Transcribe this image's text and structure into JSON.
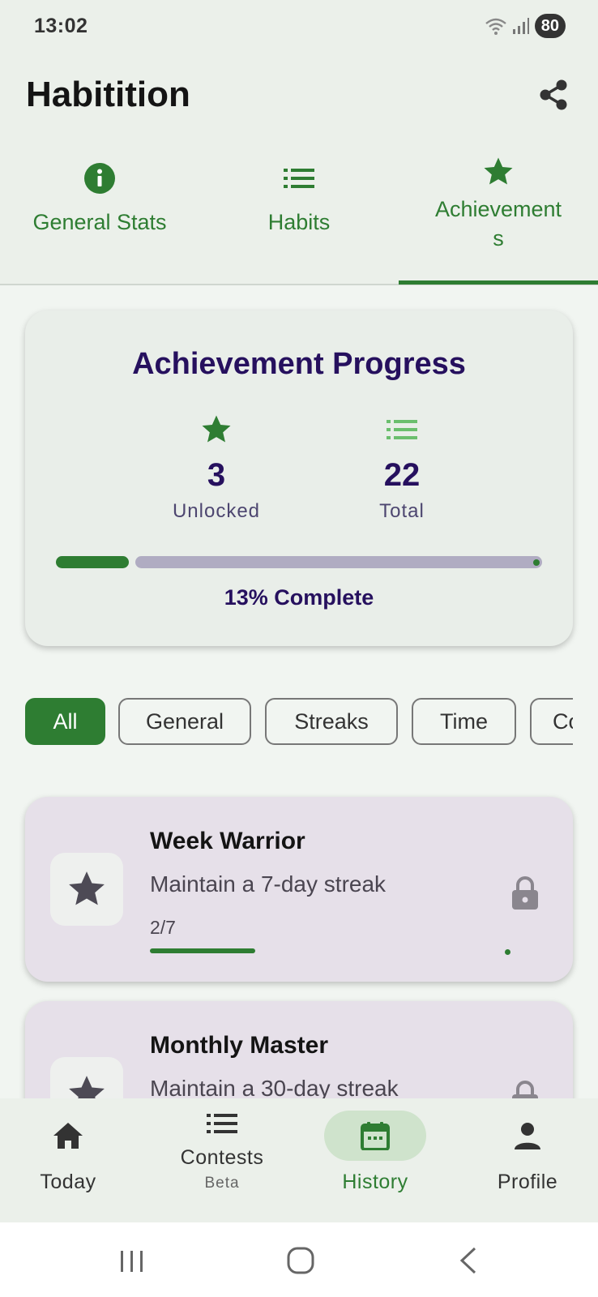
{
  "status_bar": {
    "time": "13:02",
    "battery": "80"
  },
  "app": {
    "title": "Habitition",
    "share_icon": "share-icon"
  },
  "tabs": [
    {
      "label": "General Stats",
      "icon": "info-icon"
    },
    {
      "label": "Habits",
      "icon": "list-icon"
    },
    {
      "label_line1": "Achievement",
      "label_line2": "s",
      "icon": "star-icon",
      "selected": true
    }
  ],
  "progress": {
    "title": "Achievement Progress",
    "unlocked_value": "3",
    "unlocked_label": "Unlocked",
    "total_value": "22",
    "total_label": "Total",
    "percent": 0.13,
    "complete_text": "13% Complete"
  },
  "filters": [
    {
      "label": "All",
      "selected": true
    },
    {
      "label": "General"
    },
    {
      "label": "Streaks"
    },
    {
      "label": "Time"
    },
    {
      "label": "Co"
    }
  ],
  "achievements": [
    {
      "title": "Week Warrior",
      "description": "Maintain a 7-day streak",
      "progress_text": "2/7",
      "progress": 0.2857,
      "locked": true
    },
    {
      "title": "Monthly Master",
      "description": "Maintain a 30-day streak",
      "locked": true
    }
  ],
  "bottom_nav": [
    {
      "label": "Today",
      "icon": "home-icon"
    },
    {
      "label": "Contests",
      "sub": "Beta",
      "icon": "list-icon"
    },
    {
      "label": "History",
      "icon": "calendar-icon",
      "selected": true
    },
    {
      "label": "Profile",
      "icon": "person-icon"
    }
  ],
  "colors": {
    "accent": "#2e7d32",
    "title_purple": "#26105e",
    "card_bg": "#e9eee9",
    "achievement_card_bg": "#e6e0e9"
  }
}
